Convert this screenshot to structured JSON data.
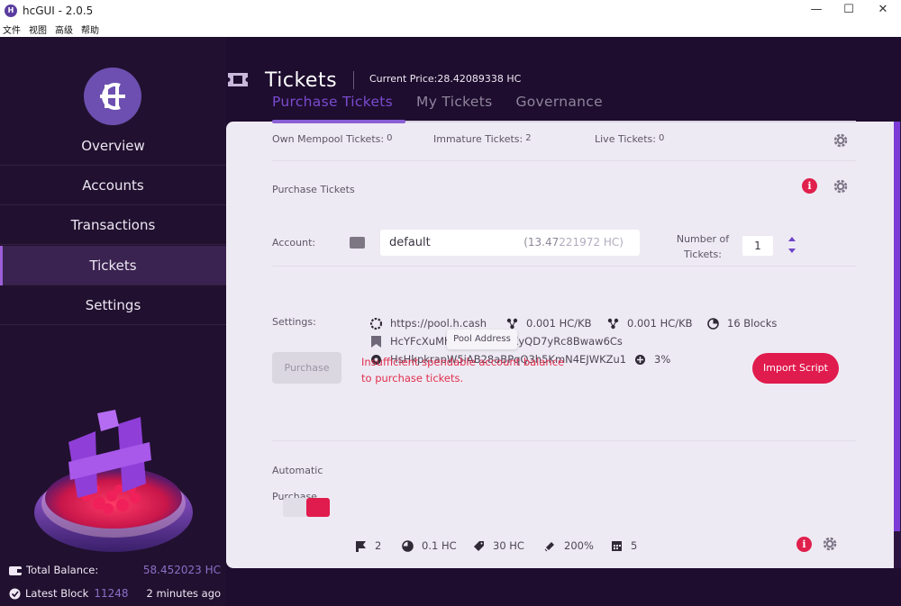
{
  "window": {
    "title": "hcGUI - 2.0.5",
    "controls": {
      "minimize": "—",
      "maximize": "☐",
      "close": "✕"
    }
  },
  "menubar": [
    "文件",
    "视图",
    "高级",
    "帮助"
  ],
  "sidebar": {
    "items": [
      {
        "label": "Overview"
      },
      {
        "label": "Accounts"
      },
      {
        "label": "Transactions"
      },
      {
        "label": "Tickets",
        "active": true
      },
      {
        "label": "Settings"
      }
    ],
    "total_balance_label": "Total Balance:",
    "total_balance_value": "58.452023 HC",
    "latest_block_label": "Latest Block",
    "latest_block_value": "11248",
    "latest_block_ago": "2 minutes ago"
  },
  "header": {
    "title": "Tickets",
    "current_price": "Current Price:28.42089338 HC"
  },
  "tabs": [
    {
      "label": "Purchase Tickets",
      "active": true
    },
    {
      "label": "My Tickets"
    },
    {
      "label": "Governance"
    }
  ],
  "stats": {
    "mempool_label": "Own Mempool Tickets:",
    "mempool_value": "0",
    "immature_label": "Immature Tickets:",
    "immature_value": "2",
    "live_label": "Live Tickets:",
    "live_value": "0"
  },
  "purchase": {
    "section_title": "Purchase Tickets",
    "account_label": "Account:",
    "account_value": "default",
    "account_balance_prefix": "(13.47",
    "account_balance_suffix": "221972 HC)",
    "number_label": "Number of Tickets:",
    "number_value": "1",
    "settings_label": "Settings:",
    "pool": "https://pool.h.cash",
    "ticket_fee": "0.001 HC/KB",
    "tx_fee": "0.001 HC/KB",
    "expiry": "16 Blocks",
    "ticket_address": "HcYFcXuMh3fiQqhah67XyQD7yRc8Bwaw6Cs",
    "pool_address": "HsHkpkrapW5iAB28aBPqQ3h5KmN4EJWKZu1",
    "pool_fee": "3%",
    "tooltip": "Pool Address",
    "purchase_button": "Purchase",
    "error_line1": "Insufficient spendable account balance",
    "error_line2": "to purchase tickets.",
    "import_button": "Import Script"
  },
  "auto": {
    "label_line1": "Automatic",
    "label_line2": "Purchase",
    "items": [
      "2",
      "0.1 HC",
      "30 HC",
      "200%",
      "5"
    ]
  },
  "colors": {
    "accent": "#7a4bd0",
    "danger": "#e01b4d",
    "sidebar_bg": "#21102f"
  }
}
